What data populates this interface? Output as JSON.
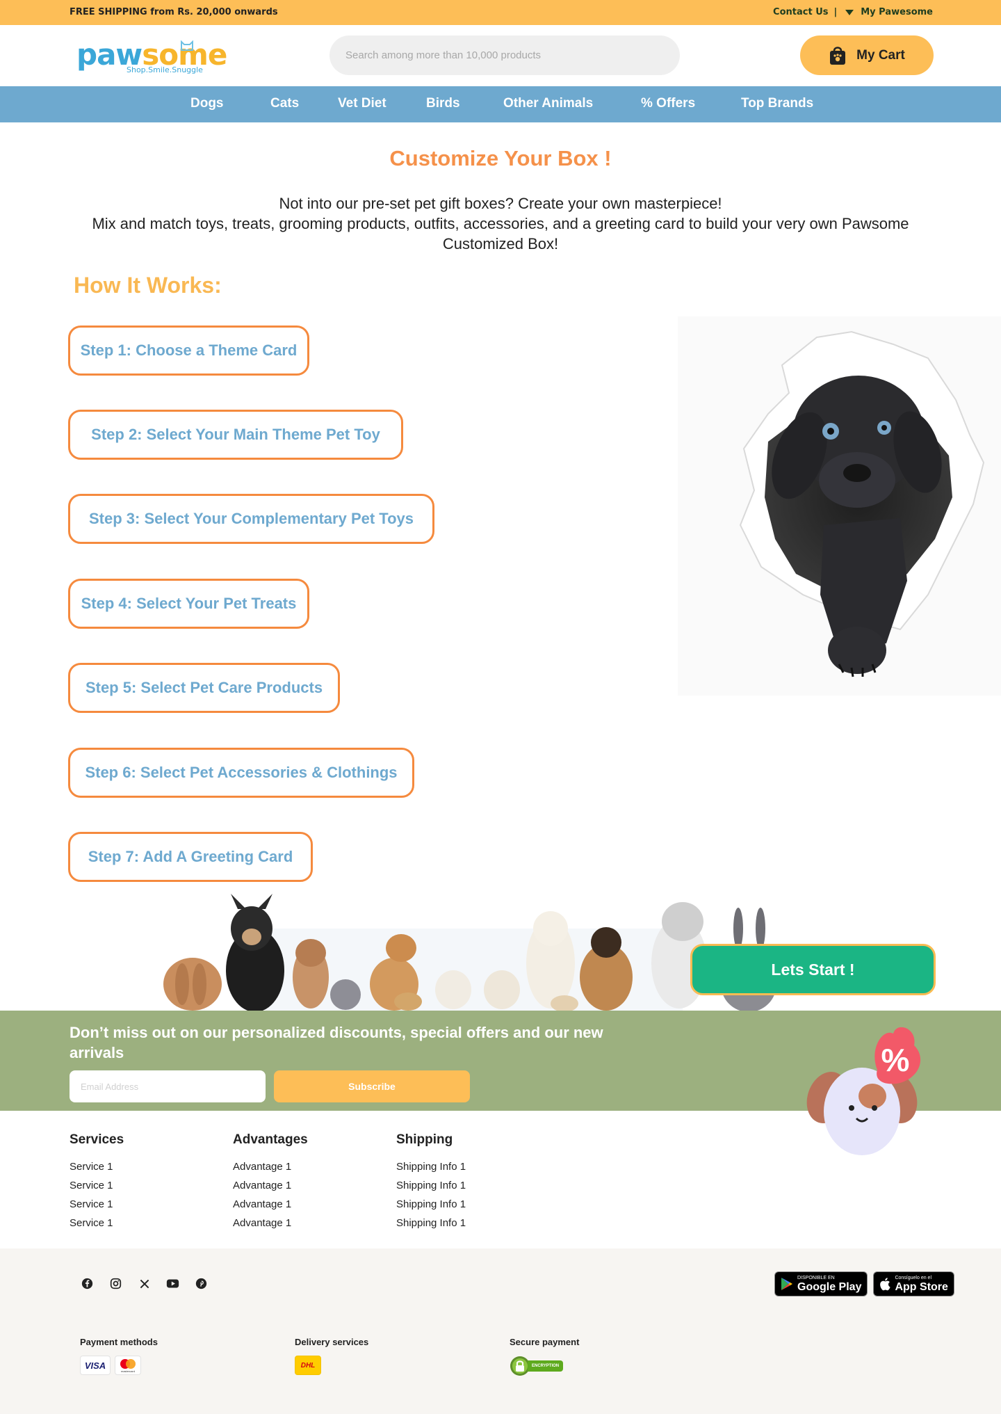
{
  "topbar": {
    "shipping": "FREE SHIPPING from Rs. 20,000 onwards",
    "contact": "Contact Us",
    "separator": "|",
    "account": "My Pawesome"
  },
  "header": {
    "logo_part1": "paw",
    "logo_part2": "some",
    "logo_tagline": "Shop.Smile.Snuggle",
    "search_placeholder": "Search among more than 10,000 products",
    "cart_label": "My Cart"
  },
  "nav": {
    "items": [
      "Dogs",
      "Cats",
      "Vet Diet",
      "Birds",
      "Other Animals",
      "% Offers",
      "Top Brands"
    ]
  },
  "main": {
    "title": "Customize Your Box !",
    "intro_line1": "Not into our pre-set pet gift boxes? Create your own masterpiece!",
    "intro_line2": "Mix and match toys, treats, grooming products, outfits, accessories, and a greeting card to build your very own Pawsome Customized Box!",
    "how_it_works": "How It Works:",
    "steps": [
      "Step 1: Choose a Theme Card",
      "Step 2: Select Your Main Theme Pet Toy",
      "Step 3: Select Your Complementary Pet Toys",
      "Step 4: Select Your Pet Treats",
      "Step 5: Select Pet Care Products",
      "Step 6: Select Pet Accessories & Clothings",
      "Step 7: Add A Greeting Card"
    ],
    "cta": "Lets Start !"
  },
  "newsletter": {
    "message": "Don’t miss out on our personalized discounts, special offers and our new arrivals",
    "email_placeholder": "Email Address",
    "subscribe": "Subscribe",
    "badge_symbol": "%"
  },
  "footer": {
    "services": {
      "title": "Services",
      "items": [
        "Service 1",
        "Service 1",
        "Service 1",
        "Service 1"
      ]
    },
    "advantages": {
      "title": "Advantages",
      "items": [
        "Advantage 1",
        "Advantage 1",
        "Advantage 1",
        "Advantage 1"
      ]
    },
    "shipping": {
      "title": "Shipping",
      "items": [
        "Shipping Info 1",
        "Shipping Info 1",
        "Shipping Info 1",
        "Shipping Info 1"
      ]
    },
    "social_icons": [
      "facebook-icon",
      "instagram-icon",
      "x-icon",
      "youtube-icon",
      "pinterest-icon"
    ],
    "google_play_small": "DISPONIBLE EN",
    "google_play_big": "Google Play",
    "app_store_small": "Consíguelo en el",
    "app_store_big": "App Store",
    "payment_title": "Payment methods",
    "visa": "VISA",
    "mastercard": "mastercard",
    "delivery_title": "Delivery services",
    "dhl": "DHL",
    "secure_title": "Secure payment",
    "encryption": "ENCRYPTION"
  },
  "colors": {
    "topbar": "#FDBE57",
    "nav": "#6EA9CF",
    "title_orange": "#F5914A",
    "step_border": "#F58A3E",
    "step_text": "#6EA9CF",
    "cta": "#1BB584",
    "newsletter": "#9CB07F"
  }
}
